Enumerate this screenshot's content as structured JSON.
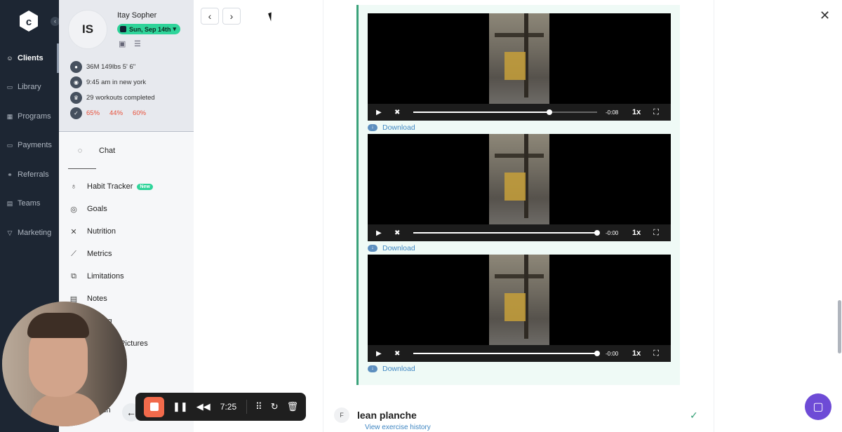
{
  "nav": {
    "items": [
      {
        "label": "Clients",
        "icon": "users-icon",
        "active": true
      },
      {
        "label": "Library",
        "icon": "book-icon",
        "active": false
      },
      {
        "label": "Programs",
        "icon": "calendar-icon",
        "active": false
      },
      {
        "label": "Payments",
        "icon": "card-icon",
        "active": false
      },
      {
        "label": "Referrals",
        "icon": "referral-icon",
        "active": false
      },
      {
        "label": "Teams",
        "icon": "teams-icon",
        "active": false
      },
      {
        "label": "Marketing",
        "icon": "funnel-icon",
        "active": false
      }
    ]
  },
  "client": {
    "initials": "IS",
    "name": "Itay Sopher",
    "date": "Sun, Sep 14th",
    "stats": {
      "profile": "36M   149lbs   5' 6\"",
      "time": "9:45 am in new york",
      "workouts": "29 workouts completed",
      "pct1": "65%",
      "pct2": "44%",
      "pct3": "60%"
    },
    "menu": {
      "chat": "Chat",
      "habit": "Habit Tracker",
      "habit_badge": "New",
      "goals": "Goals",
      "nutrition": "Nutrition",
      "metrics": "Metrics",
      "limitations": "Limitations",
      "notes": "Notes",
      "partial1": "ing",
      "partial2": "Pictures",
      "partial3": "ch"
    }
  },
  "videos": [
    {
      "time": "-0:08",
      "speed": "1x",
      "progress": 0.74,
      "download": "Download"
    },
    {
      "time": "-0:00",
      "speed": "1x",
      "progress": 1.0,
      "download": "Download"
    },
    {
      "time": "-0:00",
      "speed": "1x",
      "progress": 1.0,
      "download": "Download"
    }
  ],
  "exercise": {
    "badge": "F",
    "title": "lean planche",
    "link": "View exercise history"
  },
  "recorder": {
    "time": "7:25"
  },
  "colors": {
    "nav_bg": "#1d2633",
    "accent_green": "#2fd49a",
    "stat_red": "#e8503a",
    "link_blue": "#3f86c2",
    "record_orange": "#f26a4b",
    "chat_purple": "#6e4bd6"
  }
}
